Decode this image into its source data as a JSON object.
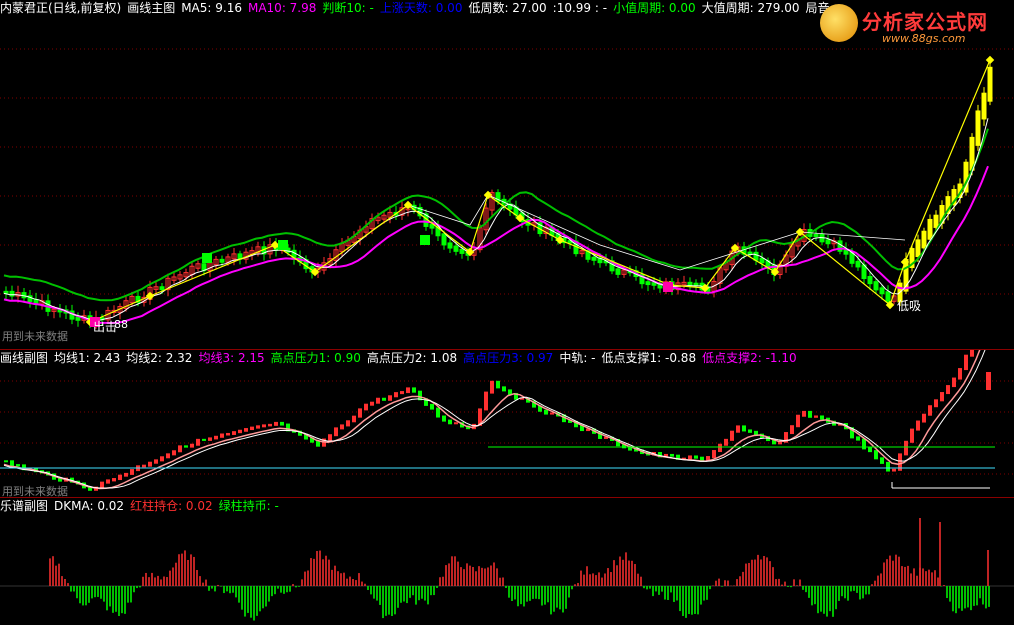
{
  "main": {
    "header": [
      {
        "text": "内蒙君正(日线,前复权)",
        "color": "#ffffff"
      },
      {
        "text": "画线主图",
        "color": "#ffffff"
      },
      {
        "text": "MA5: 9.16",
        "color": "#ffffff"
      },
      {
        "text": "MA10: 7.98",
        "color": "#ff00ff"
      },
      {
        "text": "判断10: -",
        "color": "#00ff00"
      },
      {
        "text": "上涨天数: 0.00",
        "color": "#0000ff"
      },
      {
        "text": "低周数: 27.00",
        "color": "#ffffff"
      },
      {
        "text": ":10.99 : -",
        "color": "#ffffff"
      },
      {
        "text": "小值周期: 0.00",
        "color": "#00ff00"
      },
      {
        "text": "大值周期: 279.00",
        "color": "#ffffff"
      },
      {
        "text": "局音",
        "color": "#ffffff"
      }
    ],
    "watermark": "用到未来数据",
    "annotations": {
      "sell": "出击",
      "sell_num": "88",
      "buy": "低吸"
    }
  },
  "sub1": {
    "header": [
      {
        "text": "画线副图",
        "color": "#ffffff"
      },
      {
        "text": "均线1: 2.43",
        "color": "#ffffff"
      },
      {
        "text": "均线2: 2.32",
        "color": "#ffffff"
      },
      {
        "text": "均线3: 2.15",
        "color": "#ff00ff"
      },
      {
        "text": "高点压力1: 0.90",
        "color": "#00ff00"
      },
      {
        "text": "高点压力2: 1.08",
        "color": "#ffffff"
      },
      {
        "text": "高点压力3: 0.97",
        "color": "#0000ff"
      },
      {
        "text": "中轨: -",
        "color": "#ffffff"
      },
      {
        "text": "低点支撑1: -0.88",
        "color": "#ffffff"
      },
      {
        "text": "低点支撑2: -1.10",
        "color": "#ff00ff"
      }
    ],
    "watermark": "用到未来数据"
  },
  "sub2": {
    "header": [
      {
        "text": "乐谱副图",
        "color": "#ffffff"
      },
      {
        "text": "DKMA: 0.02",
        "color": "#ffffff"
      },
      {
        "text": "红柱持仓: 0.02",
        "color": "#ff3030"
      },
      {
        "text": "绿柱持币: -",
        "color": "#00ff00"
      }
    ]
  },
  "logo": {
    "name": "分析家公式网",
    "url": "www.88gs.com",
    "icon": "smiley-ball-icon"
  },
  "colors": {
    "up": "#ff3030",
    "down": "#00ff00",
    "ma5": "#ffffff",
    "ma10": "#ff00ff",
    "grid": "#800000",
    "zigzag": "#ffff00"
  }
}
